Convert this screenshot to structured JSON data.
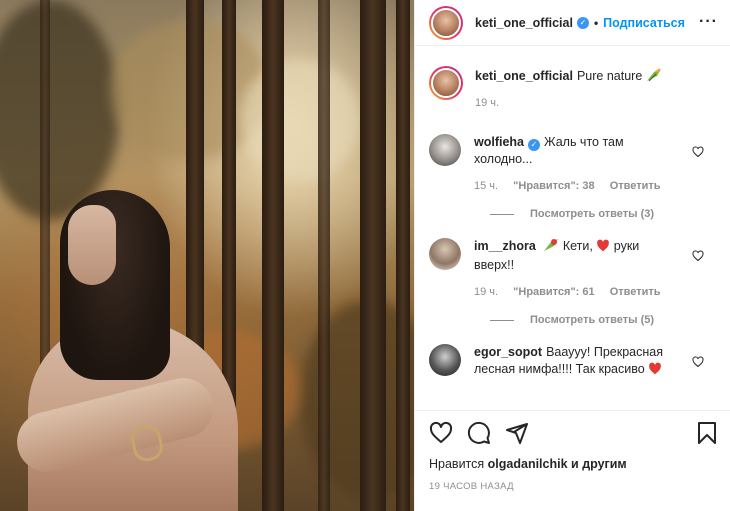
{
  "header": {
    "username": "keti_one_official",
    "dot": "•",
    "follow_label": "Подписаться",
    "more": "···"
  },
  "caption": {
    "username": "keti_one_official",
    "text": "Pure nature",
    "time": "19 ч."
  },
  "comments": [
    {
      "username": "wolfieha",
      "verified": true,
      "text": "Жаль что там холодно...",
      "time": "15 ч.",
      "likes": "\"Нравится\": 38",
      "reply_label": "Ответить",
      "view_replies": "Посмотреть ответы (3)"
    },
    {
      "username": "im__zhora",
      "verified": false,
      "text_before": "Кети,",
      "text_after": "руки вверх!!",
      "time": "19 ч.",
      "likes": "\"Нравится\": 61",
      "reply_label": "Ответить",
      "view_replies": "Посмотреть ответы (5)"
    },
    {
      "username": "egor_sopot",
      "verified": false,
      "text": "Вааууу! Прекрасная лесная нимфа!!!! Так красиво"
    }
  ],
  "likes_line": {
    "prefix": "Нравится",
    "user": "olgadanilchik",
    "suffix": "и другим"
  },
  "post_time": "19 ЧАСОВ НАЗАД",
  "icons": [
    "heart-icon",
    "comment-icon",
    "share-icon",
    "bookmark-icon",
    "verified-icon"
  ],
  "colors": {
    "accent": "#0095f6",
    "verified": "#3897f0",
    "heart": "#ed4956"
  }
}
